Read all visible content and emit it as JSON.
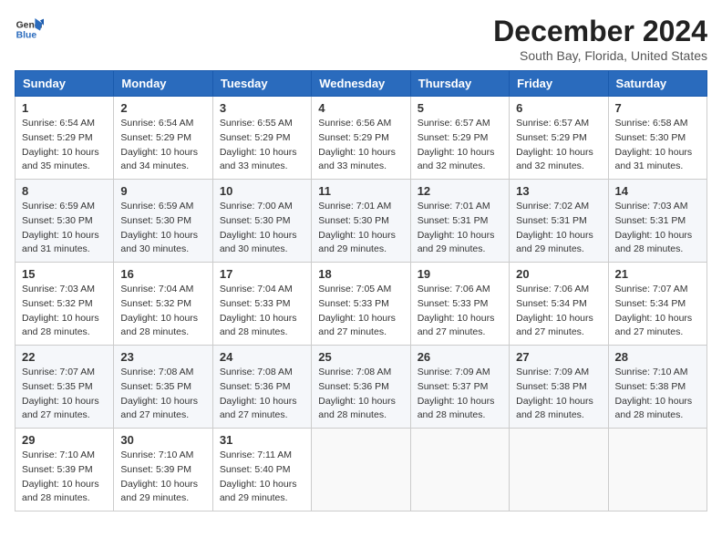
{
  "logo": {
    "line1": "General",
    "line2": "Blue"
  },
  "title": "December 2024",
  "subtitle": "South Bay, Florida, United States",
  "days_of_week": [
    "Sunday",
    "Monday",
    "Tuesday",
    "Wednesday",
    "Thursday",
    "Friday",
    "Saturday"
  ],
  "weeks": [
    [
      {
        "day": "1",
        "sunrise": "6:54 AM",
        "sunset": "5:29 PM",
        "daylight": "10 hours and 35 minutes."
      },
      {
        "day": "2",
        "sunrise": "6:54 AM",
        "sunset": "5:29 PM",
        "daylight": "10 hours and 34 minutes."
      },
      {
        "day": "3",
        "sunrise": "6:55 AM",
        "sunset": "5:29 PM",
        "daylight": "10 hours and 33 minutes."
      },
      {
        "day": "4",
        "sunrise": "6:56 AM",
        "sunset": "5:29 PM",
        "daylight": "10 hours and 33 minutes."
      },
      {
        "day": "5",
        "sunrise": "6:57 AM",
        "sunset": "5:29 PM",
        "daylight": "10 hours and 32 minutes."
      },
      {
        "day": "6",
        "sunrise": "6:57 AM",
        "sunset": "5:29 PM",
        "daylight": "10 hours and 32 minutes."
      },
      {
        "day": "7",
        "sunrise": "6:58 AM",
        "sunset": "5:30 PM",
        "daylight": "10 hours and 31 minutes."
      }
    ],
    [
      {
        "day": "8",
        "sunrise": "6:59 AM",
        "sunset": "5:30 PM",
        "daylight": "10 hours and 31 minutes."
      },
      {
        "day": "9",
        "sunrise": "6:59 AM",
        "sunset": "5:30 PM",
        "daylight": "10 hours and 30 minutes."
      },
      {
        "day": "10",
        "sunrise": "7:00 AM",
        "sunset": "5:30 PM",
        "daylight": "10 hours and 30 minutes."
      },
      {
        "day": "11",
        "sunrise": "7:01 AM",
        "sunset": "5:30 PM",
        "daylight": "10 hours and 29 minutes."
      },
      {
        "day": "12",
        "sunrise": "7:01 AM",
        "sunset": "5:31 PM",
        "daylight": "10 hours and 29 minutes."
      },
      {
        "day": "13",
        "sunrise": "7:02 AM",
        "sunset": "5:31 PM",
        "daylight": "10 hours and 29 minutes."
      },
      {
        "day": "14",
        "sunrise": "7:03 AM",
        "sunset": "5:31 PM",
        "daylight": "10 hours and 28 minutes."
      }
    ],
    [
      {
        "day": "15",
        "sunrise": "7:03 AM",
        "sunset": "5:32 PM",
        "daylight": "10 hours and 28 minutes."
      },
      {
        "day": "16",
        "sunrise": "7:04 AM",
        "sunset": "5:32 PM",
        "daylight": "10 hours and 28 minutes."
      },
      {
        "day": "17",
        "sunrise": "7:04 AM",
        "sunset": "5:33 PM",
        "daylight": "10 hours and 28 minutes."
      },
      {
        "day": "18",
        "sunrise": "7:05 AM",
        "sunset": "5:33 PM",
        "daylight": "10 hours and 27 minutes."
      },
      {
        "day": "19",
        "sunrise": "7:06 AM",
        "sunset": "5:33 PM",
        "daylight": "10 hours and 27 minutes."
      },
      {
        "day": "20",
        "sunrise": "7:06 AM",
        "sunset": "5:34 PM",
        "daylight": "10 hours and 27 minutes."
      },
      {
        "day": "21",
        "sunrise": "7:07 AM",
        "sunset": "5:34 PM",
        "daylight": "10 hours and 27 minutes."
      }
    ],
    [
      {
        "day": "22",
        "sunrise": "7:07 AM",
        "sunset": "5:35 PM",
        "daylight": "10 hours and 27 minutes."
      },
      {
        "day": "23",
        "sunrise": "7:08 AM",
        "sunset": "5:35 PM",
        "daylight": "10 hours and 27 minutes."
      },
      {
        "day": "24",
        "sunrise": "7:08 AM",
        "sunset": "5:36 PM",
        "daylight": "10 hours and 27 minutes."
      },
      {
        "day": "25",
        "sunrise": "7:08 AM",
        "sunset": "5:36 PM",
        "daylight": "10 hours and 28 minutes."
      },
      {
        "day": "26",
        "sunrise": "7:09 AM",
        "sunset": "5:37 PM",
        "daylight": "10 hours and 28 minutes."
      },
      {
        "day": "27",
        "sunrise": "7:09 AM",
        "sunset": "5:38 PM",
        "daylight": "10 hours and 28 minutes."
      },
      {
        "day": "28",
        "sunrise": "7:10 AM",
        "sunset": "5:38 PM",
        "daylight": "10 hours and 28 minutes."
      }
    ],
    [
      {
        "day": "29",
        "sunrise": "7:10 AM",
        "sunset": "5:39 PM",
        "daylight": "10 hours and 28 minutes."
      },
      {
        "day": "30",
        "sunrise": "7:10 AM",
        "sunset": "5:39 PM",
        "daylight": "10 hours and 29 minutes."
      },
      {
        "day": "31",
        "sunrise": "7:11 AM",
        "sunset": "5:40 PM",
        "daylight": "10 hours and 29 minutes."
      },
      null,
      null,
      null,
      null
    ]
  ],
  "labels": {
    "sunrise": "Sunrise: ",
    "sunset": "Sunset: ",
    "daylight": "Daylight: "
  }
}
